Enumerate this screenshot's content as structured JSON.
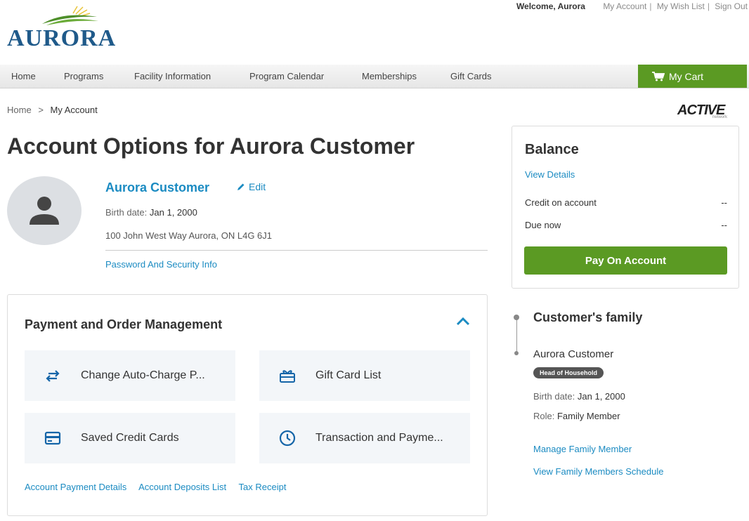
{
  "header": {
    "logo_text": "AURORA",
    "welcome": "Welcome, Aurora",
    "links": [
      "My Account",
      "My Wish List",
      "Sign Out"
    ]
  },
  "nav": {
    "items": [
      "Home",
      "Programs",
      "Facility Information",
      "Program Calendar",
      "Memberships",
      "Gift Cards"
    ],
    "cart_label": "My Cart"
  },
  "breadcrumb": {
    "home": "Home",
    "separator": ">",
    "current": "My Account"
  },
  "active_logo": {
    "brand": "ACTIVE",
    "sub": "network"
  },
  "page_title": "Account Options for Aurora Customer",
  "profile": {
    "name": "Aurora Customer",
    "edit_label": "Edit",
    "birth_label": "Birth date:",
    "birth_value": "Jan 1, 2000",
    "address": "100 John West Way Aurora, ON L4G 6J1",
    "password_link": "Password And Security Info"
  },
  "payment_management": {
    "title": "Payment and Order Management",
    "tiles": [
      {
        "label": "Change Auto-Charge P...",
        "icon": "swap-arrows-icon"
      },
      {
        "label": "Gift Card List",
        "icon": "gift-card-icon"
      },
      {
        "label": "Saved Credit Cards",
        "icon": "credit-card-icon"
      },
      {
        "label": "Transaction and Payme...",
        "icon": "clock-icon"
      }
    ],
    "links": [
      "Account Payment Details",
      "Account Deposits List",
      "Tax Receipt"
    ]
  },
  "balance": {
    "title": "Balance",
    "view_details": "View Details",
    "credit_label": "Credit on account",
    "credit_value": "--",
    "due_label": "Due now",
    "due_value": "--",
    "pay_button": "Pay On Account"
  },
  "family": {
    "title": "Customer's family",
    "member_name": "Aurora Customer",
    "badge": "Head of Household",
    "birth_label": "Birth date:",
    "birth_value": "Jan 1, 2000",
    "role_label": "Role:",
    "role_value": "Family Member",
    "manage_link": "Manage Family Member",
    "schedule_link": "View Family Members Schedule"
  },
  "colors": {
    "link_blue": "#1b8bc2",
    "action_green": "#5b9a23",
    "logo_blue": "#1f5a8a"
  }
}
